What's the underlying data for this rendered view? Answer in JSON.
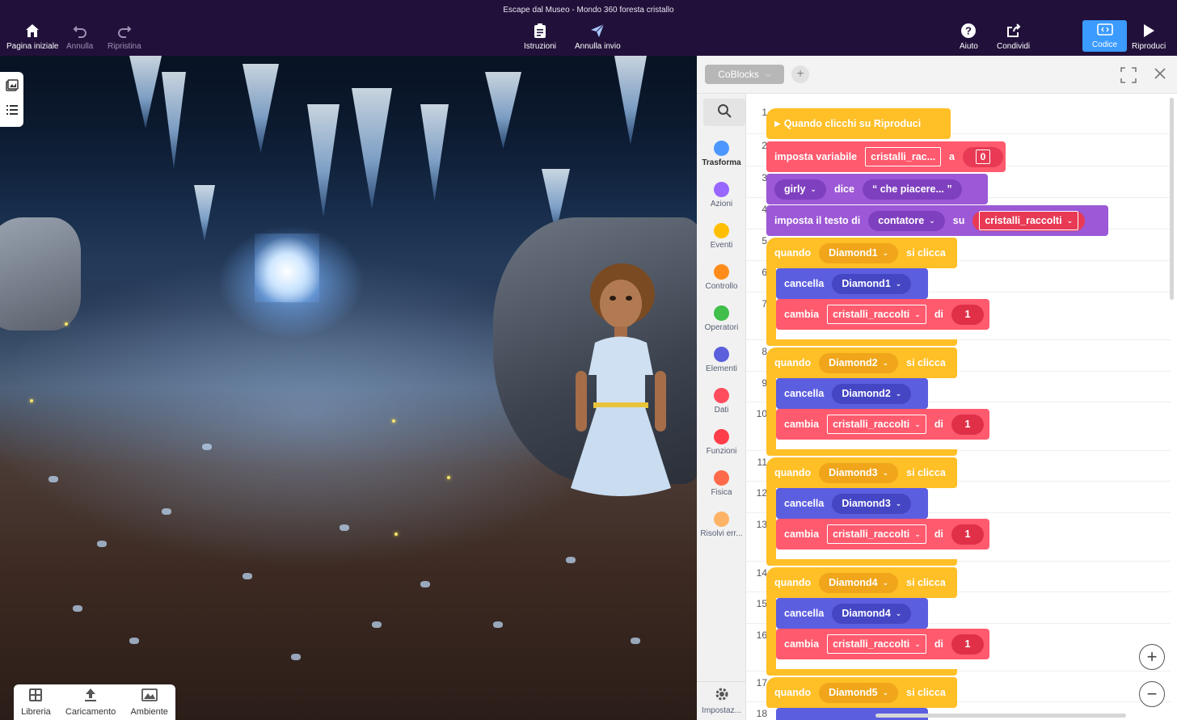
{
  "window": {
    "title": "Escape dal Museo - Mondo 360 foresta cristallo"
  },
  "toolbar": {
    "home": "Pagina iniziale",
    "undo": "Annulla",
    "redo": "Ripristina",
    "instructions": "Istruzioni",
    "unsend": "Annulla invio",
    "help": "Aiuto",
    "share": "Condividi",
    "code": "Codice",
    "play": "Riproduci"
  },
  "stage_bottom": {
    "library": "Libreria",
    "upload": "Caricamento",
    "environment": "Ambiente"
  },
  "panel": {
    "tab_label": "CoBlocks",
    "add_tab": "+"
  },
  "categories": [
    {
      "label": "Trasforma",
      "color": "#4c97ff"
    },
    {
      "label": "Azioni",
      "color": "#9966ff"
    },
    {
      "label": "Eventi",
      "color": "#ffbf00"
    },
    {
      "label": "Controllo",
      "color": "#ff8c1a"
    },
    {
      "label": "Operatori",
      "color": "#40bf4a"
    },
    {
      "label": "Elementi",
      "color": "#5b5fdb"
    },
    {
      "label": "Dati",
      "color": "#ff4d5e"
    },
    {
      "label": "Funzioni",
      "color": "#ff3d4a"
    },
    {
      "label": "Fisica",
      "color": "#ff6b4a"
    },
    {
      "label": "Risolvi err...",
      "color": "#ffb366"
    }
  ],
  "settings_label": "Impostaz...",
  "code": {
    "line_numbers": [
      "1",
      "2",
      "3",
      "4",
      "5",
      "6",
      "7",
      "8",
      "9",
      "10",
      "11",
      "12",
      "13",
      "14",
      "15",
      "16",
      "17",
      "18"
    ],
    "start": "Quando clicchi su Riproduci",
    "set_var": {
      "label": "imposta variabile",
      "var": "cristalli_rac...",
      "to": "a",
      "value": "0"
    },
    "say": {
      "actor": "girly",
      "verb": "dice",
      "text": "“ che piacere... ”"
    },
    "set_text": {
      "label": "imposta il testo di",
      "target": "contatore",
      "on": "su",
      "var": "cristalli_raccolti"
    },
    "when": "quando",
    "clicked": "si clicca",
    "delete": "cancella",
    "change": "cambia",
    "change_var": "cristalli_raccolti",
    "by": "di",
    "amount": "1",
    "diamonds": [
      "Diamond1",
      "Diamond2",
      "Diamond3",
      "Diamond4",
      "Diamond5"
    ]
  },
  "zoom": {
    "in": "+",
    "out": "−"
  }
}
